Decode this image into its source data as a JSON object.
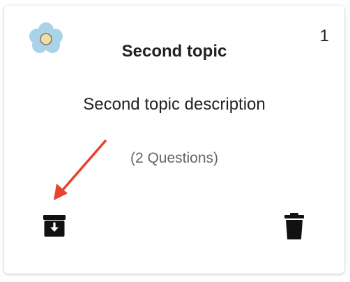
{
  "card": {
    "icon": "flower-icon",
    "order_number": "1",
    "title": "Second topic",
    "description": "Second topic description",
    "question_count": "(2 Questions)",
    "actions": {
      "archive_icon": "archive-icon",
      "delete_icon": "trash-icon"
    }
  },
  "annotation": {
    "type": "arrow",
    "color": "#e8412c",
    "points_to": "archive-button"
  }
}
